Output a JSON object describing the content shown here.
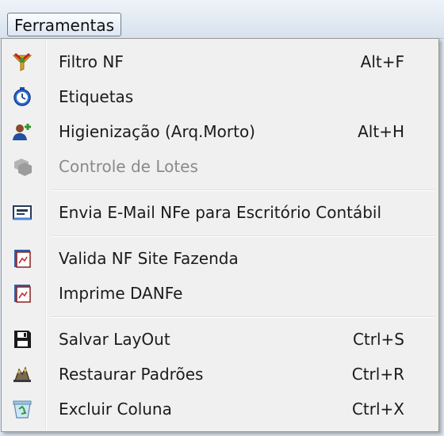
{
  "menubar": {
    "title": "Ferramentas"
  },
  "menu": {
    "items": [
      {
        "label": "Filtro NF",
        "shortcut": "Alt+F",
        "icon": "filter-icon",
        "enabled": true
      },
      {
        "label": "Etiquetas",
        "shortcut": "",
        "icon": "stopwatch-icon",
        "enabled": true
      },
      {
        "label": "Higienização (Arq.Morto)",
        "shortcut": "Alt+H",
        "icon": "user-add-icon",
        "enabled": true
      },
      {
        "label": "Controle de Lotes",
        "shortcut": "",
        "icon": "stack-icon",
        "enabled": false
      },
      {
        "label": "Envia E-Mail NFe para Escritório Contábil",
        "shortcut": "",
        "icon": "email-icon",
        "enabled": true
      },
      {
        "label": "Valida NF Site Fazenda",
        "shortcut": "",
        "icon": "document-icon",
        "enabled": true
      },
      {
        "label": "Imprime DANFe",
        "shortcut": "",
        "icon": "document-icon",
        "enabled": true
      },
      {
        "label": "Salvar LayOut",
        "shortcut": "Ctrl+S",
        "icon": "floppy-disk-icon",
        "enabled": true
      },
      {
        "label": "Restaurar Padrões",
        "shortcut": "Ctrl+R",
        "icon": "restore-icon",
        "enabled": true
      },
      {
        "label": "Excluir Coluna",
        "shortcut": "Ctrl+X",
        "icon": "recycle-bin-icon",
        "enabled": true
      }
    ]
  }
}
